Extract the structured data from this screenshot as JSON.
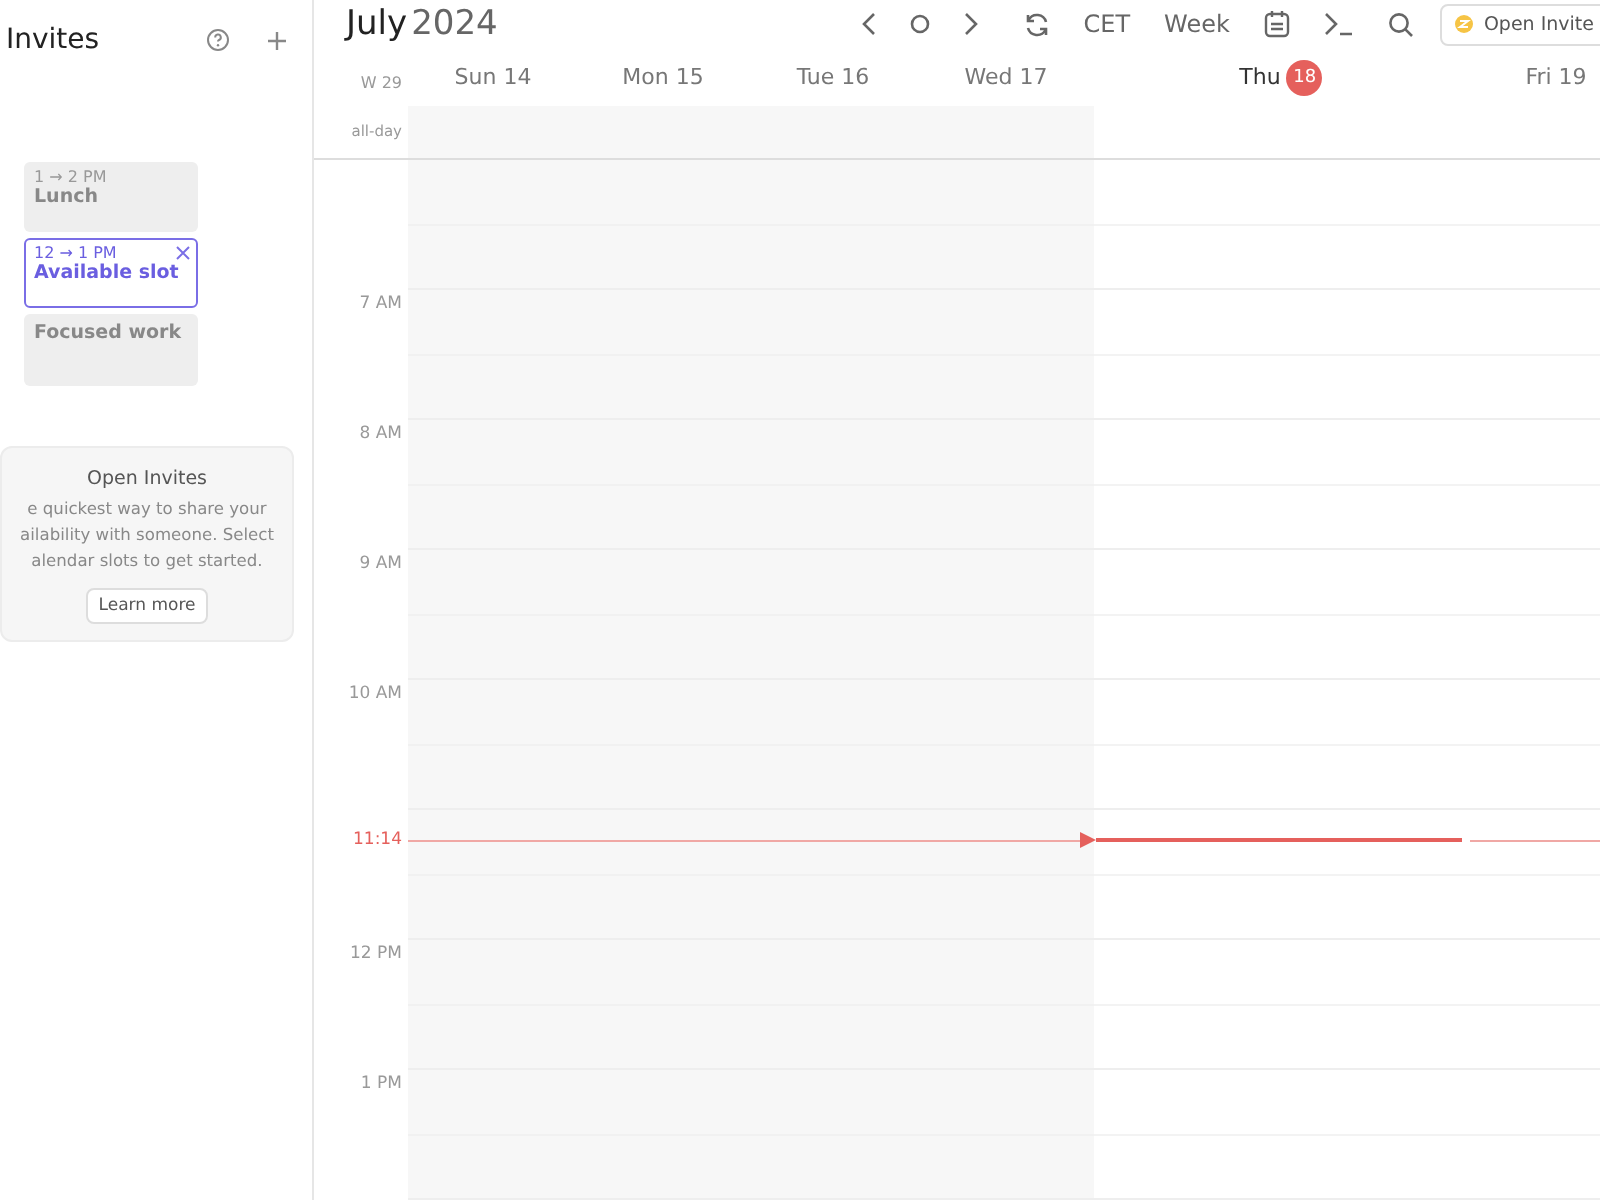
{
  "sidebar": {
    "title": "Invites",
    "slots": [
      {
        "time": "1 → 2 PM",
        "title": "Lunch",
        "selected": false
      },
      {
        "time": "12 → 1 PM",
        "title": "Available slot",
        "selected": true
      },
      {
        "title": "Focused work",
        "selected": false
      }
    ],
    "info": {
      "title": "Open Invites",
      "lines": [
        "e quickest way to share your",
        "ailability with someone. Select",
        "alendar slots to get started."
      ],
      "button": "Learn more"
    }
  },
  "header": {
    "month": "July",
    "year": "2024",
    "timezone": "CET",
    "view": "Week",
    "invite_button": "Open Invite"
  },
  "week_label": "W 29",
  "allday_label": "all-day",
  "days": [
    {
      "weekday": "Sun",
      "date": "14",
      "today": false,
      "past": true
    },
    {
      "weekday": "Mon",
      "date": "15",
      "today": false,
      "past": true
    },
    {
      "weekday": "Tue",
      "date": "16",
      "today": false,
      "past": true
    },
    {
      "weekday": "Wed",
      "date": "17",
      "today": false,
      "past": true
    },
    {
      "weekday": "Thu",
      "date": "18",
      "today": true,
      "past": false
    },
    {
      "weekday": "Fri",
      "date": "19",
      "today": false,
      "past": false
    }
  ],
  "hours": [
    "7 AM",
    "8 AM",
    "9 AM",
    "10 AM",
    "12 PM",
    "1 PM"
  ],
  "now_label": "11:14"
}
